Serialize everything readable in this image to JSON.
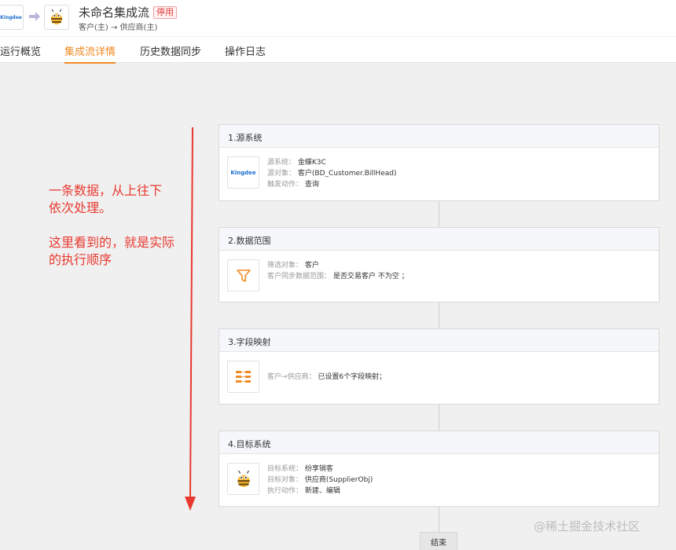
{
  "header": {
    "source_logo_text": "Kingdee",
    "title": "未命名集成流",
    "status": "停用",
    "subtitle": "客户(主) → 供应商(主)"
  },
  "tabs": [
    {
      "label": "运行概览",
      "active": false
    },
    {
      "label": "集成流详情",
      "active": true
    },
    {
      "label": "历史数据同步",
      "active": false
    },
    {
      "label": "操作日志",
      "active": false
    }
  ],
  "annotation": {
    "line1": "一条数据，从上往下",
    "line2": "依次处理。",
    "line3": "这里看到的，就是实际",
    "line4": "的执行顺序",
    "color": "#e8392f"
  },
  "cards": [
    {
      "title": "1.源系统",
      "icon": "kingdee-logo",
      "icon_text": "Kingdee",
      "rows": [
        {
          "label": "源系统：",
          "value": "金蝶K3C"
        },
        {
          "label": "源对象：",
          "value": "客户(BD_Customer.BillHead)"
        },
        {
          "label": "触发动作：",
          "value": "查询"
        }
      ]
    },
    {
      "title": "2.数据范围",
      "icon": "filter-icon",
      "rows": [
        {
          "label": "筛选对象：",
          "value": "客户"
        },
        {
          "label": "客户同步数据范围：",
          "value": "是否交易客户 不为空 ；"
        }
      ]
    },
    {
      "title": "3.字段映射",
      "icon": "field-mapping-icon",
      "rows": [
        {
          "label": "客户→供应商：",
          "value": "已设置6个字段映射；"
        }
      ]
    },
    {
      "title": "4.目标系统",
      "icon": "bee-logo",
      "rows": [
        {
          "label": "目标系统：",
          "value": "纷享销客"
        },
        {
          "label": "目标对象：",
          "value": "供应商(SupplierObj)"
        },
        {
          "label": "执行动作：",
          "value": "新建、编辑"
        }
      ]
    }
  ],
  "end_label": "结束",
  "watermark": "@稀土掘金技术社区",
  "colors": {
    "accent": "#f08a24",
    "status": "#e03c3c",
    "annotation": "#e8392f"
  }
}
